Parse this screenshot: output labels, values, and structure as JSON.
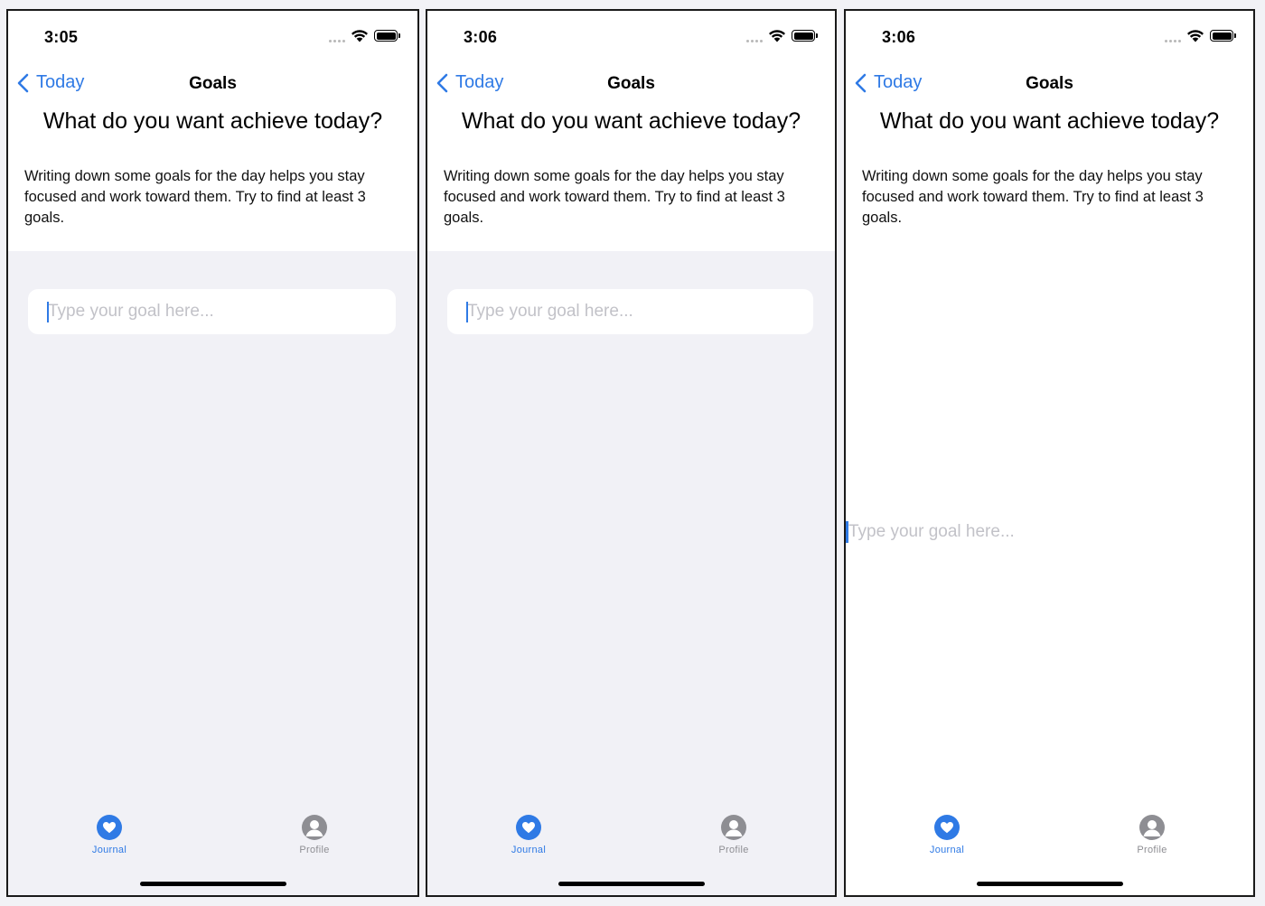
{
  "screens": [
    {
      "time": "3:05",
      "nav": {
        "back_label": "Today",
        "title": "Goals"
      },
      "heading": "What do you want achieve today?",
      "description": "Writing down some goals for the day helps you stay focused and work toward them. Try to find at least 3 goals.",
      "goal_input": {
        "placeholder": "Type your goal here...",
        "value": ""
      },
      "tabs": [
        {
          "label": "Journal",
          "icon": "heart-icon",
          "active": true
        },
        {
          "label": "Profile",
          "icon": "person-icon",
          "active": false
        }
      ]
    },
    {
      "time": "3:06",
      "nav": {
        "back_label": "Today",
        "title": "Goals"
      },
      "heading": "What do you want achieve today?",
      "description": "Writing down some goals for the day helps you stay focused and work toward them. Try to find at least 3 goals.",
      "goal_input": {
        "placeholder": "Type your goal here...",
        "value": ""
      },
      "tabs": [
        {
          "label": "Journal",
          "icon": "heart-icon",
          "active": true
        },
        {
          "label": "Profile",
          "icon": "person-icon",
          "active": false
        }
      ]
    },
    {
      "time": "3:06",
      "nav": {
        "back_label": "Today",
        "title": "Goals"
      },
      "heading": "What do you want achieve today?",
      "description": "Writing down some goals for the day helps you stay focused and work toward them. Try to find at least 3 goals.",
      "goal_input": {
        "placeholder": "Type your goal here...",
        "value": ""
      },
      "tabs": [
        {
          "label": "Journal",
          "icon": "heart-icon",
          "active": true
        },
        {
          "label": "Profile",
          "icon": "person-icon",
          "active": false
        }
      ]
    }
  ],
  "colors": {
    "accent": "#2f7ae5",
    "inactive": "#8e8e93",
    "grouped_background": "#f1f1f6",
    "placeholder": "#c2c2c8"
  }
}
